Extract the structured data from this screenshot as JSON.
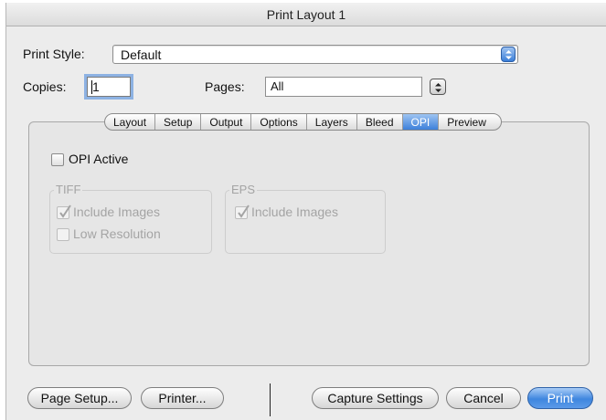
{
  "window": {
    "title": "Print Layout 1"
  },
  "print_style": {
    "label": "Print Style:",
    "value": "Default"
  },
  "copies": {
    "label": "Copies:",
    "value": "1"
  },
  "pages": {
    "label": "Pages:",
    "value": "All"
  },
  "tabs": [
    {
      "label": "Layout",
      "active": false
    },
    {
      "label": "Setup",
      "active": false
    },
    {
      "label": "Output",
      "active": false
    },
    {
      "label": "Options",
      "active": false
    },
    {
      "label": "Layers",
      "active": false
    },
    {
      "label": "Bleed",
      "active": false
    },
    {
      "label": "OPI",
      "active": true
    },
    {
      "label": "Preview",
      "active": false
    }
  ],
  "opi": {
    "active_label": "OPI Active",
    "active_checked": false,
    "tiff": {
      "title": "TIFF",
      "include_images_label": "Include Images",
      "include_images_checked": true,
      "low_resolution_label": "Low Resolution",
      "low_resolution_checked": false
    },
    "eps": {
      "title": "EPS",
      "include_images_label": "Include Images",
      "include_images_checked": true
    }
  },
  "buttons": {
    "page_setup": "Page Setup...",
    "printer": "Printer...",
    "capture_settings": "Capture Settings",
    "cancel": "Cancel",
    "print": "Print"
  },
  "colors": {
    "accent": "#3d80da",
    "disabled_text": "#a4a4a4"
  }
}
